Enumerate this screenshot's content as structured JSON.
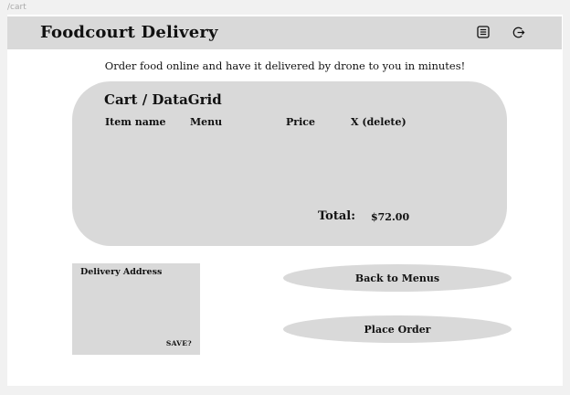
{
  "route": "/cart",
  "header": {
    "title": "Foodcourt Delivery",
    "icons": [
      "menu-list-icon",
      "logout-icon"
    ]
  },
  "tagline": "Order food online and have it delivered by drone to you in minutes!",
  "cart": {
    "title": "Cart / DataGrid",
    "columns": [
      "Item name",
      "Menu",
      "Price",
      "X (delete)"
    ],
    "total_label": "Total:",
    "total_value": "$72.00"
  },
  "address": {
    "label": "Delivery Address",
    "save_label": "SAVE?"
  },
  "actions": {
    "back_label": "Back to Menus",
    "place_label": "Place Order"
  },
  "colors": {
    "panel": "#d9d9d9",
    "background": "#ffffff"
  }
}
